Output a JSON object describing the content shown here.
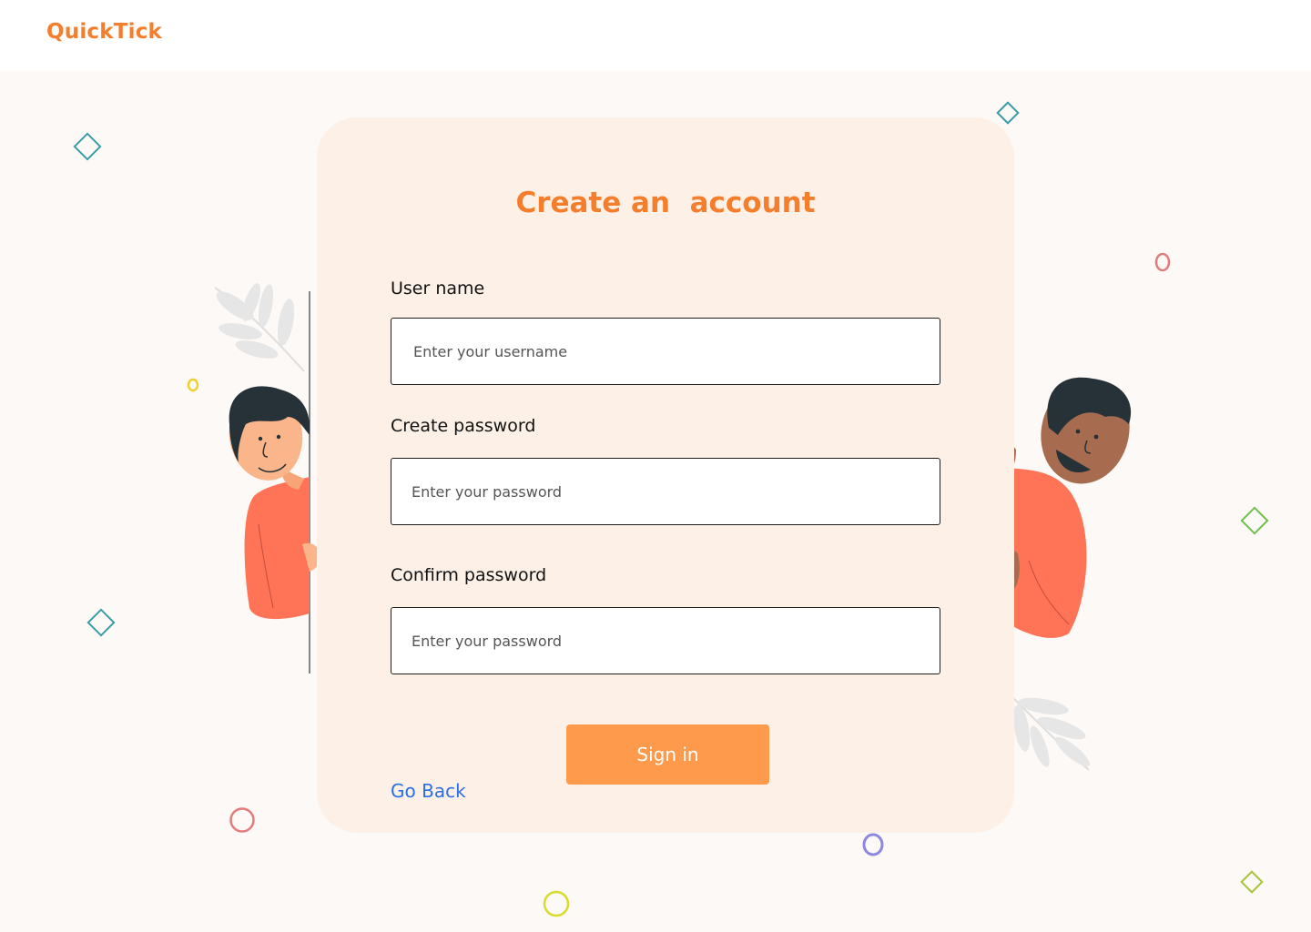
{
  "app": {
    "brand": "QuickTick"
  },
  "form": {
    "title": "Create an  account",
    "username": {
      "label": "User name",
      "placeholder": "Enter your username",
      "value": ""
    },
    "password": {
      "label": "Create password",
      "placeholder": "Enter your password",
      "value": ""
    },
    "confirm": {
      "label": "Confirm password",
      "placeholder": "Enter your password",
      "value": ""
    },
    "submit_label": "Sign in",
    "back_link": "Go Back"
  },
  "colors": {
    "brand": "#F47E2C",
    "button": "#FE9A4C",
    "link": "#2B6FE4",
    "card": "#FDF0E6",
    "page": "#FDF9F6"
  },
  "illustrations": [
    "man-peeking-left-illustration",
    "man-peeking-right-illustration",
    "leaf-decoration"
  ]
}
